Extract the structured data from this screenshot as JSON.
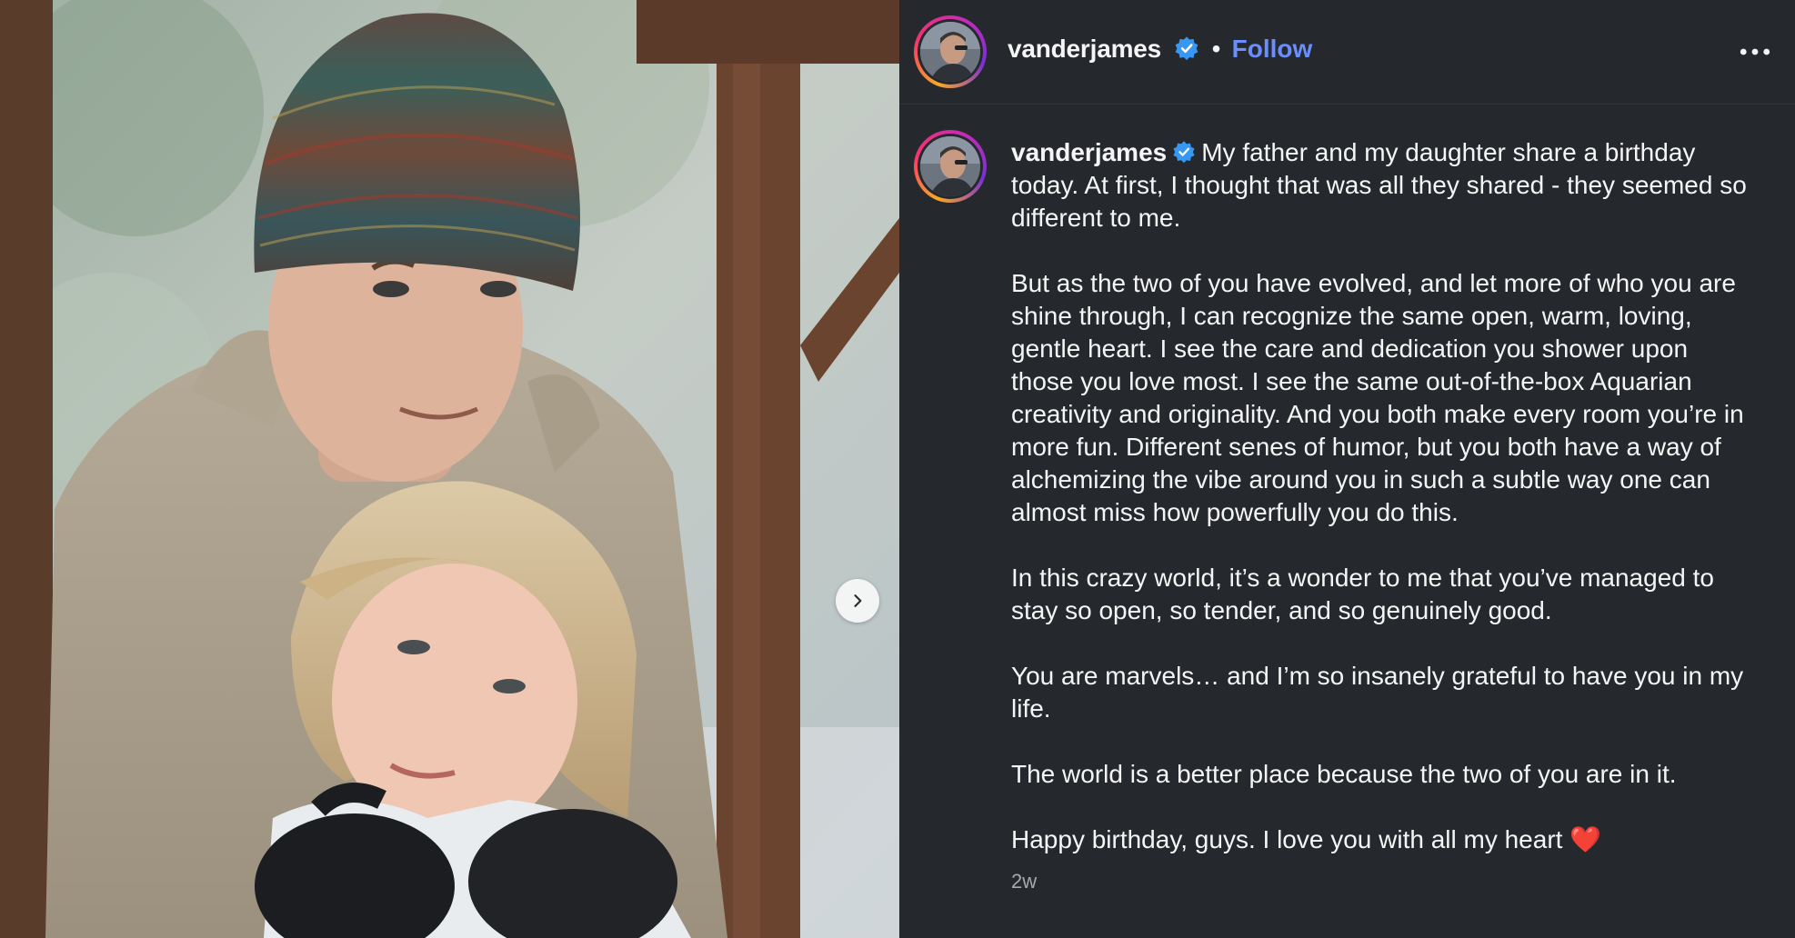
{
  "post": {
    "username": "vanderjames",
    "verified": true,
    "separator": "•",
    "follow_label": "Follow",
    "more_icon": "more-horizontal-icon",
    "timestamp": "2w"
  },
  "caption": {
    "paragraphs": [
      "My father and my daughter share a birthday today. At first, I thought that was all they shared - they seemed so different to me.",
      "But as the two of you have evolved, and let more of who you are shine through, I can recognize the same open, warm, loving, gentle heart. I see the care and dedication you shower upon those you love most. I see the same out-of-the-box Aquarian creativity and originality. And you both make every room you’re in more fun. Different senes of humor, but you both have a way of alchemizing the vibe around you in such a subtle way one can almost miss how powerfully you do this.",
      "In this crazy world, it’s a wonder to me that you’ve managed to stay so open, so tender, and so genuinely good.",
      "You are marvels… and I’m so insanely grateful to have you in my life.",
      "The world is a better place because the two of you are in it.",
      "Happy birthday, guys. I love you with all my heart"
    ],
    "heart_emoji": "❤️"
  },
  "colors": {
    "background": "#25292e",
    "follow": "#6b8eff",
    "verified": "#3897f0",
    "timestamp": "#a8a8a8"
  },
  "media": {
    "next_icon": "chevron-right-icon"
  }
}
